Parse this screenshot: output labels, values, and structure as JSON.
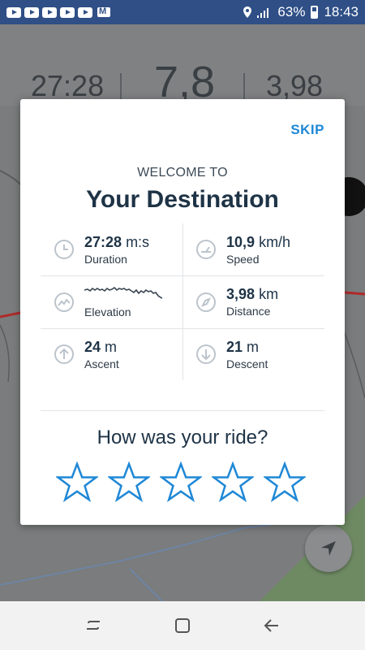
{
  "status_bar": {
    "battery": "63%",
    "time": "18:43",
    "icons": [
      "youtube-icon",
      "youtube-icon",
      "youtube-icon",
      "youtube-icon",
      "youtube-icon",
      "gmail-icon",
      "location-icon",
      "signal-icon",
      "battery-icon"
    ]
  },
  "background": {
    "duration": "27:28",
    "speed": "7,8",
    "distance": "3,98"
  },
  "modal": {
    "skip_label": "SKIP",
    "welcome": "WELCOME TO",
    "destination": "Your Destination",
    "stats": {
      "duration": {
        "value": "27:28",
        "unit": "m:s",
        "label": "Duration",
        "icon": "clock-icon"
      },
      "speed": {
        "value": "10,9",
        "unit": "km/h",
        "label": "Speed",
        "icon": "speedometer-icon"
      },
      "elevation": {
        "label": "Elevation",
        "icon": "elevation-icon"
      },
      "distance": {
        "value": "3,98",
        "unit": "km",
        "label": "Distance",
        "icon": "compass-icon"
      },
      "ascent": {
        "value": "24",
        "unit": "m",
        "label": "Ascent",
        "icon": "arrow-up-circle-icon"
      },
      "descent": {
        "value": "21",
        "unit": "m",
        "label": "Descent",
        "icon": "arrow-down-circle-icon"
      }
    },
    "rating_question": "How was your ride?",
    "rating": {
      "max": 5,
      "selected": 0
    }
  },
  "colors": {
    "accent": "#1f88d6",
    "heading": "#1e3346",
    "status_bar": "#2f4f86"
  }
}
